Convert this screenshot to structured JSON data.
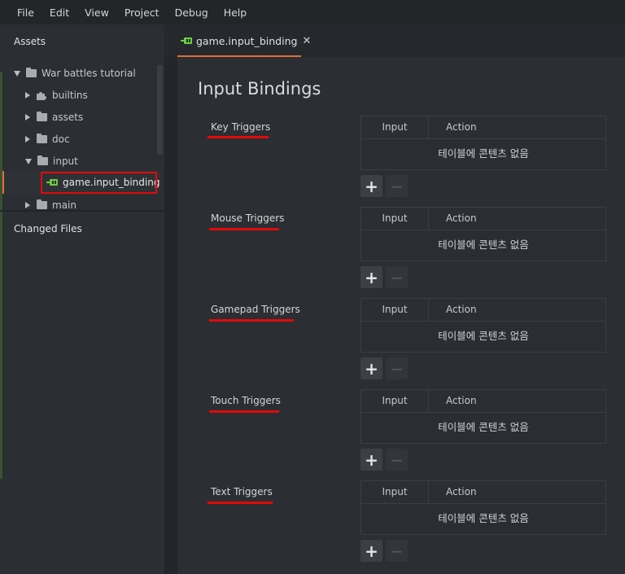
{
  "menu": [
    "File",
    "Edit",
    "View",
    "Project",
    "Debug",
    "Help"
  ],
  "assets_panel": {
    "title": "Assets",
    "tree": [
      {
        "label": "War battles tutorial",
        "icon": "folder-icon",
        "expanded": true
      },
      {
        "label": "builtins",
        "icon": "puzzle-icon",
        "expanded": false
      },
      {
        "label": "assets",
        "icon": "folder-icon",
        "expanded": false
      },
      {
        "label": "doc",
        "icon": "folder-icon",
        "expanded": false
      },
      {
        "label": "input",
        "icon": "folder-icon",
        "expanded": true
      },
      {
        "label": "game.input_binding",
        "icon": "input-binding-icon",
        "selected": true
      },
      {
        "label": "main",
        "icon": "folder-icon",
        "expanded": false
      }
    ]
  },
  "changed_files": {
    "title": "Changed Files"
  },
  "tab": {
    "label": "game.input_binding",
    "close": "✕"
  },
  "editor": {
    "title": "Input Bindings",
    "columns": {
      "input": "Input",
      "action": "Action"
    },
    "empty_text": "테이블에 콘텐츠 없음",
    "add_label": "+",
    "remove_label": "−",
    "sections": [
      {
        "label": "Key Triggers"
      },
      {
        "label": "Mouse Triggers"
      },
      {
        "label": "Gamepad Triggers"
      },
      {
        "label": "Touch Triggers"
      },
      {
        "label": "Text Triggers"
      }
    ]
  },
  "colors": {
    "accent": "#e0703a",
    "annotation": "#e20a0a",
    "icon_green": "#6fcb3f"
  }
}
